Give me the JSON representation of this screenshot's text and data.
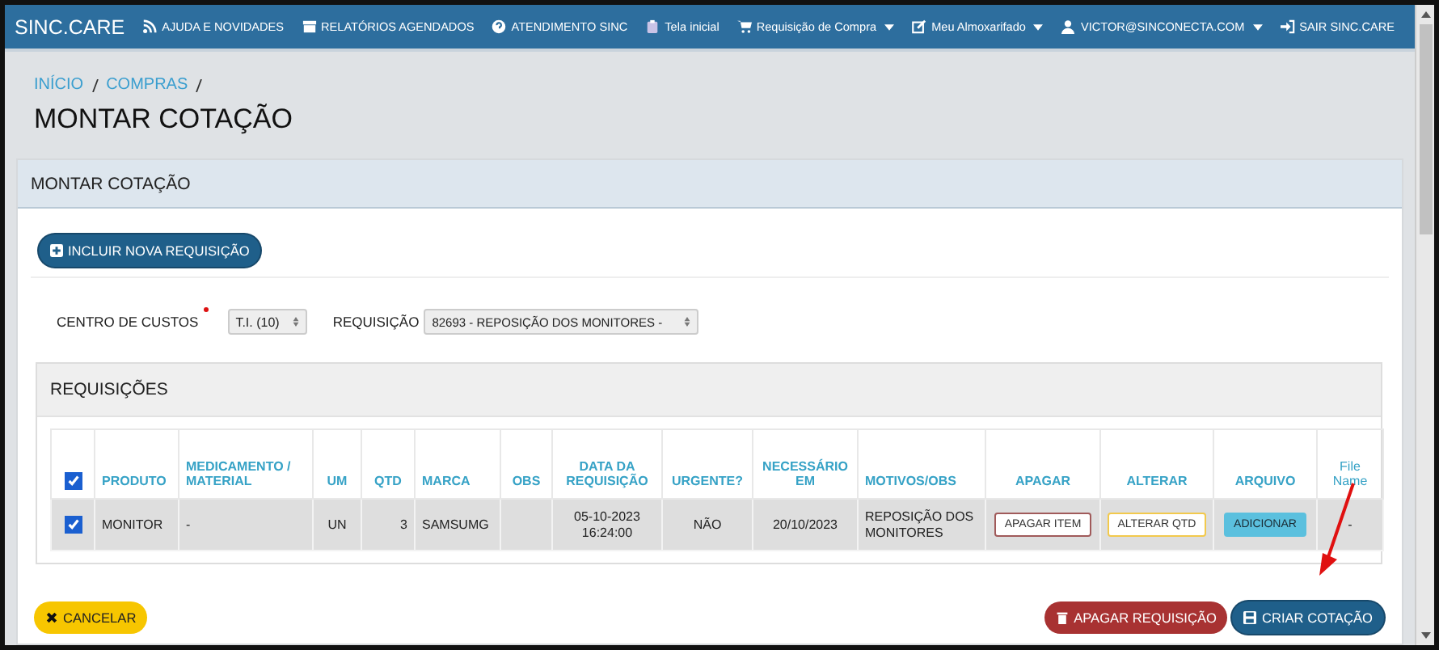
{
  "nav": {
    "brand": "SINC.CARE",
    "items": [
      {
        "label": "AJUDA E NOVIDADES",
        "dropdown": false
      },
      {
        "label": "RELATÓRIOS AGENDADOS",
        "dropdown": false
      },
      {
        "label": "ATENDIMENTO SINC",
        "dropdown": false
      },
      {
        "label": "Tela inicial",
        "dropdown": false
      },
      {
        "label": "Requisição de Compra",
        "dropdown": true
      },
      {
        "label": "Meu Almoxarifado",
        "dropdown": true
      },
      {
        "label": "VICTOR@SINCONECTA.COM",
        "dropdown": true
      },
      {
        "label": "SAIR SINC.CARE",
        "dropdown": false
      }
    ]
  },
  "breadcrumb": [
    "INÍCIO",
    "COMPRAS"
  ],
  "page_title": "MONTAR COTAÇÃO",
  "panel": {
    "title": "MONTAR COTAÇÃO",
    "add_button": "INCLUIR NOVA REQUISIÇÃO",
    "filters": [
      {
        "label": "CENTRO DE CUSTOS",
        "required": true,
        "value": "T.I. (10)"
      },
      {
        "label": "REQUISIÇÃO",
        "required": false,
        "value": "82693 - REPOSIÇÃO DOS MONITORES -"
      }
    ],
    "subpanel": {
      "title": "REQUISIÇÕES",
      "select_all_checked": true,
      "columns": [
        "PRODUTO",
        "MEDICAMENTO / MATERIAL",
        "UM",
        "QTD",
        "MARCA",
        "OBS",
        "DATA DA REQUISIÇÃO",
        "URGENTE?",
        "NECESSÁRIO EM",
        "MOTIVOS/OBS",
        "APAGAR",
        "ALTERAR",
        "ARQUIVO",
        "File Name"
      ],
      "rows": [
        {
          "checked": true,
          "cells": [
            {
              "kind": "text",
              "text": "MONITOR"
            },
            {
              "kind": "text",
              "text": "-"
            },
            {
              "kind": "text",
              "text": "UN"
            },
            {
              "kind": "text",
              "text": "3"
            },
            {
              "kind": "text",
              "text": "SAMSUMG"
            },
            {
              "kind": "text",
              "text": ""
            },
            {
              "kind": "text",
              "text": "05-10-2023 16:24:00"
            },
            {
              "kind": "text",
              "text": "NÃO"
            },
            {
              "kind": "text",
              "text": "20/10/2023"
            },
            {
              "kind": "text",
              "text": "REPOSIÇÃO DOS MONITORES"
            },
            {
              "kind": "danger",
              "text": "APAGAR ITEM"
            },
            {
              "kind": "warning",
              "text": "ALTERAR QTD"
            },
            {
              "kind": "info",
              "text": "ADICIONAR"
            },
            {
              "kind": "text",
              "text": "-"
            }
          ]
        }
      ]
    }
  },
  "footer": {
    "cancel": "CANCELAR",
    "delete": "APAGAR REQUISIÇÃO",
    "create": "CRIAR COTAÇÃO"
  }
}
